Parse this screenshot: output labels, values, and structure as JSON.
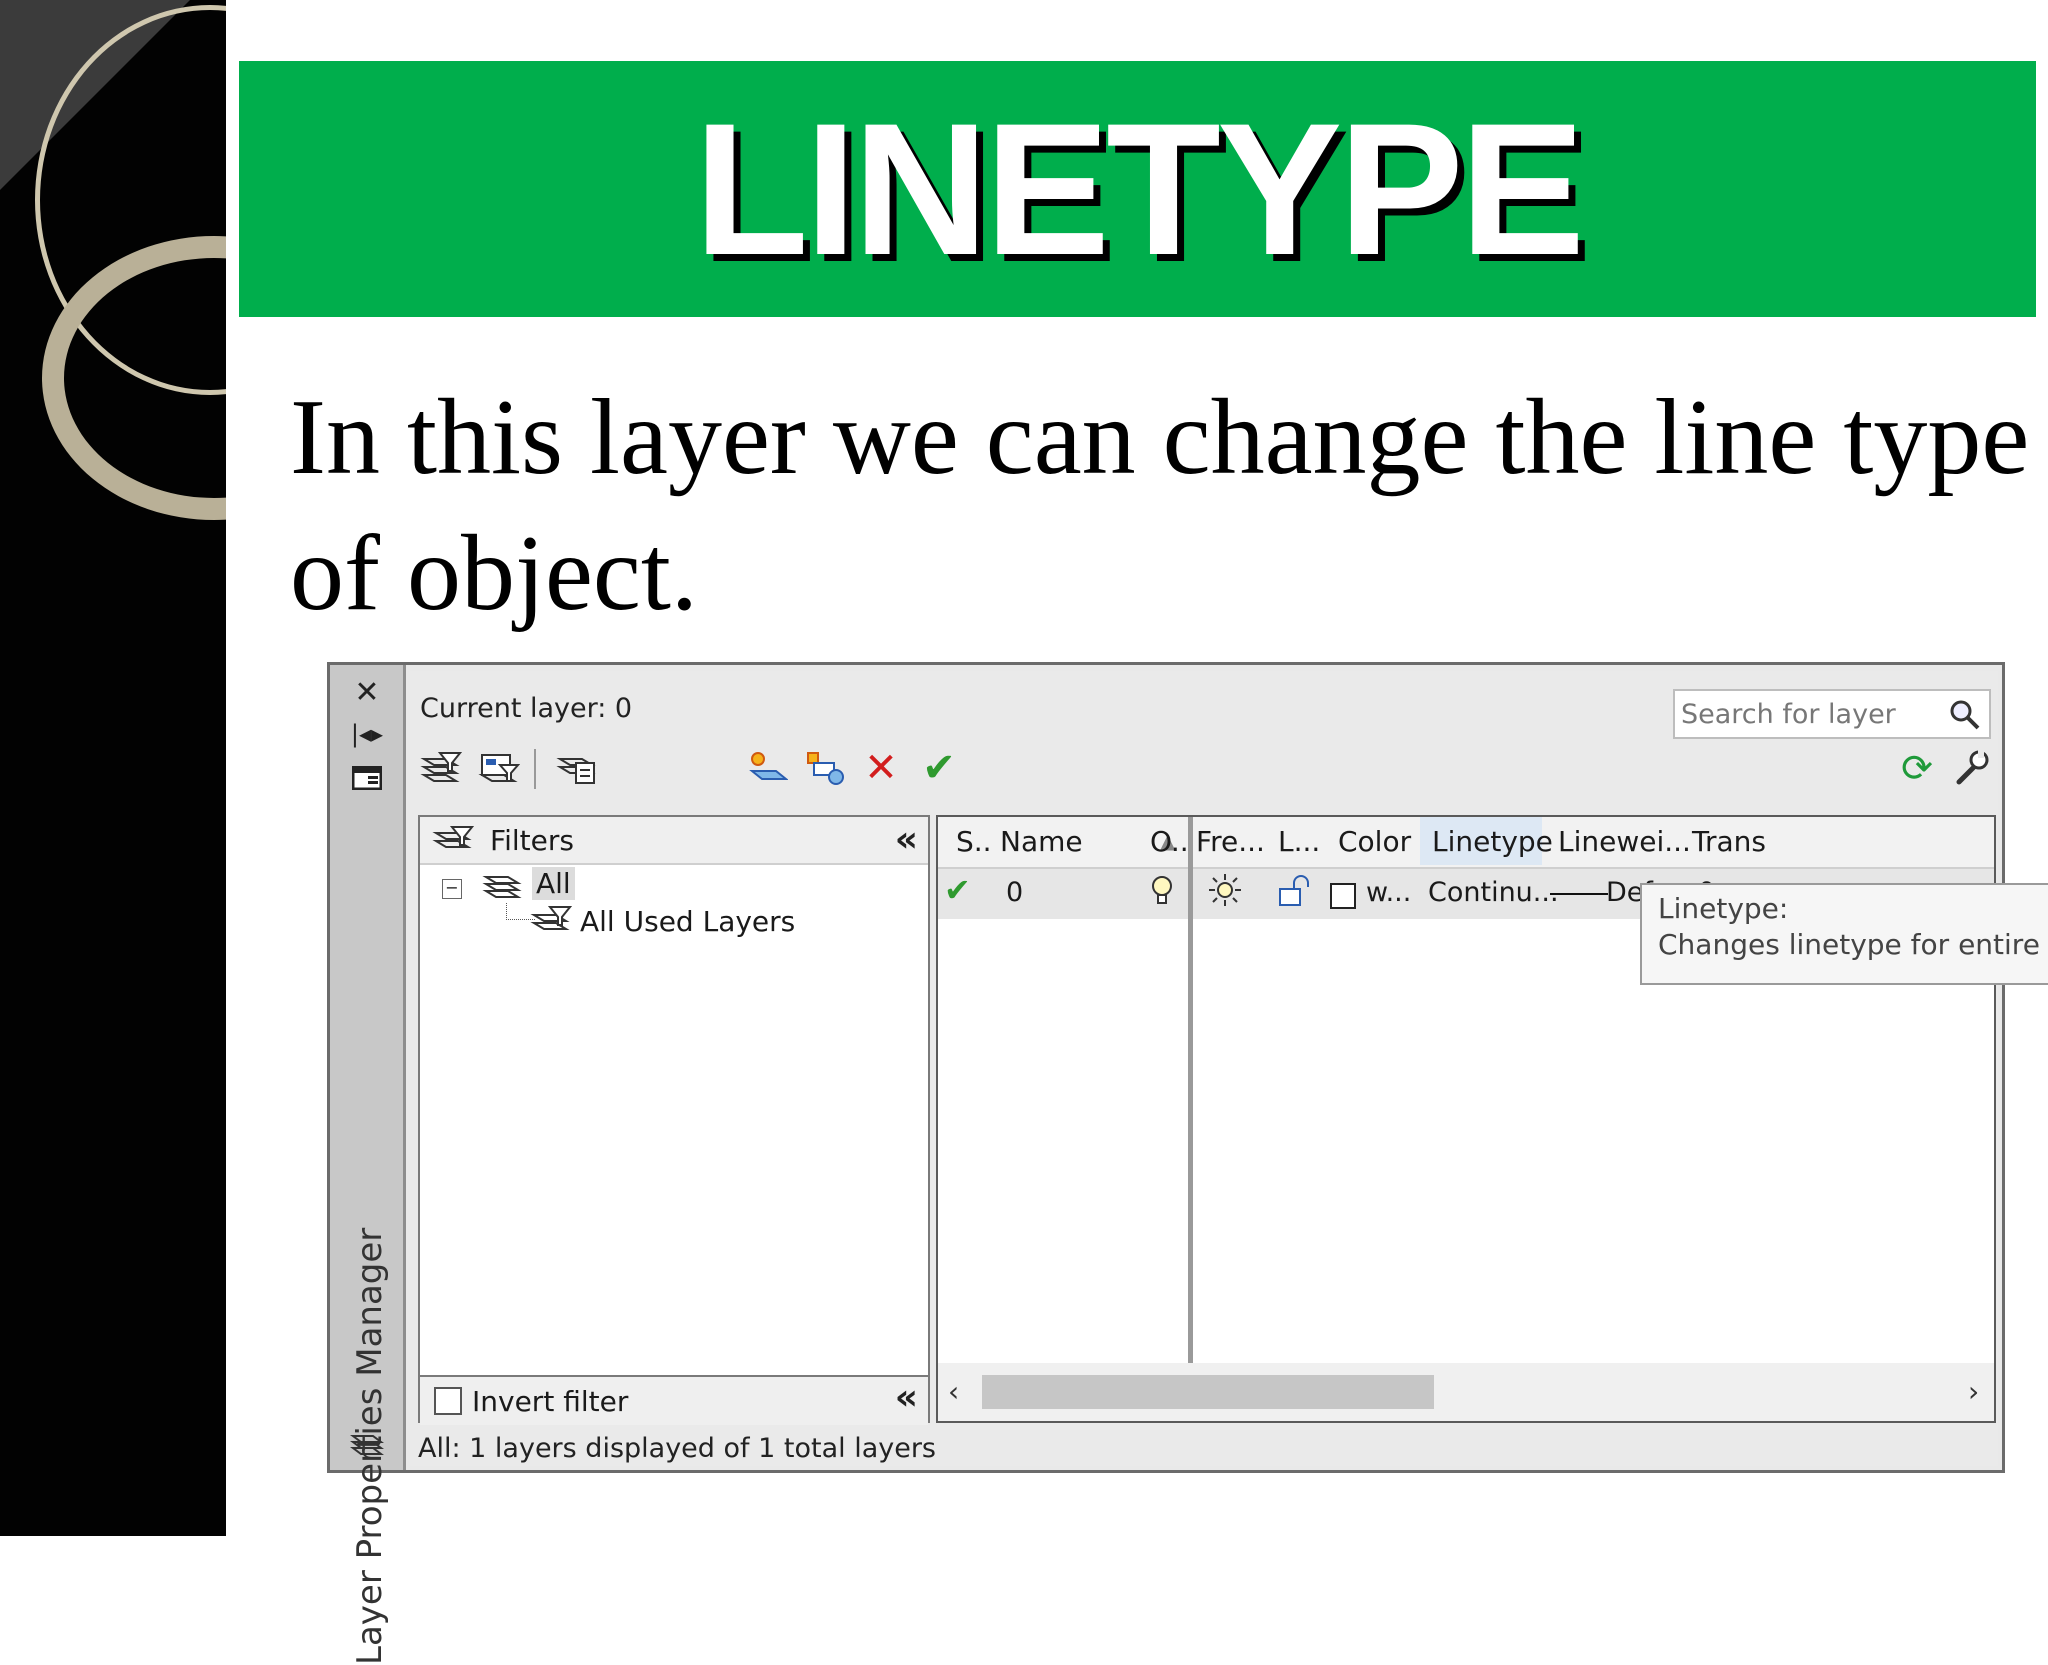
{
  "slide": {
    "title": "LINETYPE",
    "body": "In this layer we can change the line type of object."
  },
  "colors": {
    "title_banner": "#00ae4c",
    "left_strip": "#020202",
    "ring": "#cfc7ae"
  },
  "layer_manager": {
    "panel_title": "Layer Properties Manager",
    "current_layer": "Current layer: 0",
    "search_placeholder": "Search for layer",
    "side_icons": [
      "close-icon",
      "auto-hide-icon",
      "properties-icon",
      "layers-icon"
    ],
    "toolbar_icons": [
      "new-property-filter-icon",
      "new-group-filter-icon",
      "layer-states-manager-icon",
      "new-layer-icon",
      "new-layer-vp-frozen-icon",
      "delete-layer-icon",
      "set-current-icon",
      "refresh-icon",
      "settings-icon"
    ],
    "filters": {
      "header": "Filters",
      "tree": [
        "All",
        "All Used Layers"
      ],
      "invert_label": "Invert filter"
    },
    "grid": {
      "columns": [
        "S..",
        "Name",
        "O..",
        "Fre...",
        "L...",
        "Color",
        "Linetype",
        "Linewei...",
        "Trans"
      ],
      "rows": [
        {
          "status": "current",
          "name": "0",
          "on": "bulb-on-icon",
          "freeze": "sun-icon",
          "lock": "unlocked-icon",
          "color": "w...",
          "linetype": "Continu...",
          "lineweight": "Defa...",
          "transparency": "0"
        }
      ]
    },
    "tooltip": {
      "title": "Linetype:",
      "text": "Changes linetype for entire layer"
    },
    "status": "All: 1 layers displayed of 1 total layers"
  }
}
